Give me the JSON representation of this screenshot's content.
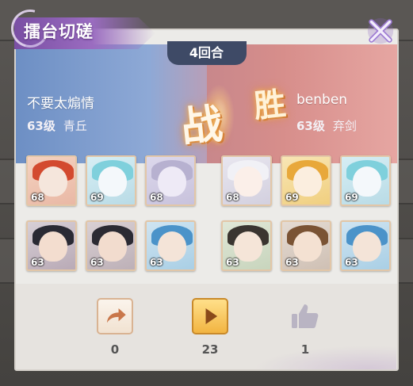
{
  "dialog": {
    "title": "擂台切磋",
    "close_icon": "close-x-icon"
  },
  "battle": {
    "round_label": "4回合",
    "result_left": "战",
    "result_right": "胜"
  },
  "players": {
    "left": {
      "name": "不要太煽情",
      "level": "63级",
      "school": "青丘",
      "color": "#7f9fd2"
    },
    "right": {
      "name": "benben",
      "level": "63级",
      "school": "弃剑",
      "color": "#d6898a"
    }
  },
  "teams": {
    "left": [
      {
        "level": "68",
        "icon": "red-beast-portrait"
      },
      {
        "level": "69",
        "icon": "white-dragon-portrait"
      },
      {
        "level": "68",
        "icon": "silver-spirit-portrait"
      },
      {
        "level": "63",
        "icon": "dark-hair-hero-portrait"
      },
      {
        "level": "63",
        "icon": "dark-hair-hero-portrait"
      },
      {
        "level": "63",
        "icon": "blue-hair-hero-portrait"
      }
    ],
    "right": [
      {
        "level": "68",
        "icon": "white-fox-girl-portrait"
      },
      {
        "level": "69",
        "icon": "golden-dragon-portrait"
      },
      {
        "level": "69",
        "icon": "white-dragon-portrait"
      },
      {
        "level": "63",
        "icon": "green-girl-portrait"
      },
      {
        "level": "63",
        "icon": "brown-hair-hero-portrait"
      },
      {
        "level": "63",
        "icon": "blue-hair-hero-portrait"
      }
    ]
  },
  "actions": {
    "share": {
      "icon": "share-arrow-icon",
      "count": "0"
    },
    "play": {
      "icon": "play-icon",
      "count": "23"
    },
    "like": {
      "icon": "thumbs-up-icon",
      "count": "1"
    }
  }
}
